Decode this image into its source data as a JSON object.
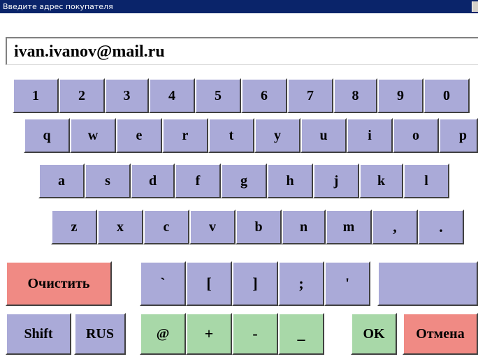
{
  "window": {
    "title": "Введите адрес покупателя"
  },
  "input": {
    "value": "ivan.ivanov@mail.ru"
  },
  "rows": {
    "digits": [
      "1",
      "2",
      "3",
      "4",
      "5",
      "6",
      "7",
      "8",
      "9",
      "0"
    ],
    "row1": [
      "q",
      "w",
      "e",
      "r",
      "t",
      "y",
      "u",
      "i",
      "o",
      "p"
    ],
    "row2": [
      "a",
      "s",
      "d",
      "f",
      "g",
      "h",
      "j",
      "k",
      "l"
    ],
    "row3": [
      "z",
      "x",
      "c",
      "v",
      "b",
      "n",
      "m",
      ",",
      "."
    ],
    "special": [
      "`",
      "[",
      "]",
      ";",
      "'",
      ""
    ]
  },
  "buttons": {
    "clear": "Очистить",
    "shift": "Shift",
    "lang": "RUS",
    "at": "@",
    "plus": "+",
    "minus": "-",
    "underscore": "_",
    "ok": "OK",
    "cancel": "Отмена"
  },
  "colors": {
    "key": "#aaaad8",
    "action_red": "#f08a84",
    "action_green": "#a8d8a8",
    "titlebar": "#0a246a"
  }
}
